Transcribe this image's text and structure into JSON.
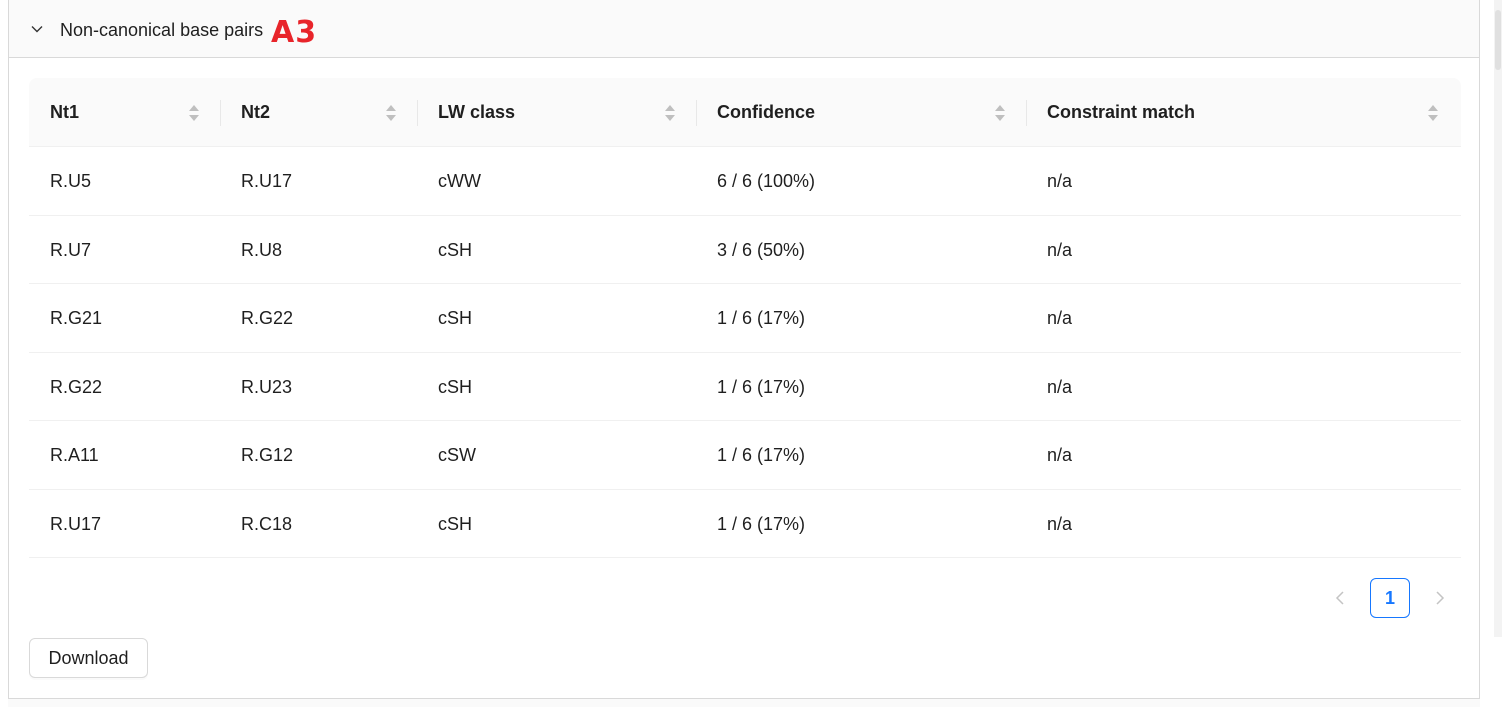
{
  "panel": {
    "title": "Non-canonical base pairs",
    "annotation": "A3",
    "annotation_color": "#e8242a"
  },
  "table": {
    "columns": [
      "Nt1",
      "Nt2",
      "LW class",
      "Confidence",
      "Constraint match"
    ],
    "rows": [
      [
        "R.U5",
        "R.U17",
        "cWW",
        "6 / 6 (100%)",
        "n/a"
      ],
      [
        "R.U7",
        "R.U8",
        "cSH",
        "3 / 6 (50%)",
        "n/a"
      ],
      [
        "R.G21",
        "R.G22",
        "cSH",
        "1 / 6 (17%)",
        "n/a"
      ],
      [
        "R.G22",
        "R.U23",
        "cSH",
        "1 / 6 (17%)",
        "n/a"
      ],
      [
        "R.A11",
        "R.G12",
        "cSW",
        "1 / 6 (17%)",
        "n/a"
      ],
      [
        "R.U17",
        "R.C18",
        "cSH",
        "1 / 6 (17%)",
        "n/a"
      ]
    ]
  },
  "pagination": {
    "current_page": "1",
    "accent": "#1677ff"
  },
  "actions": {
    "download_label": "Download"
  },
  "icons": {
    "collapse": "chevron-down-icon",
    "sort": "sort-icon",
    "prev": "chevron-left-icon",
    "next": "chevron-right-icon"
  }
}
